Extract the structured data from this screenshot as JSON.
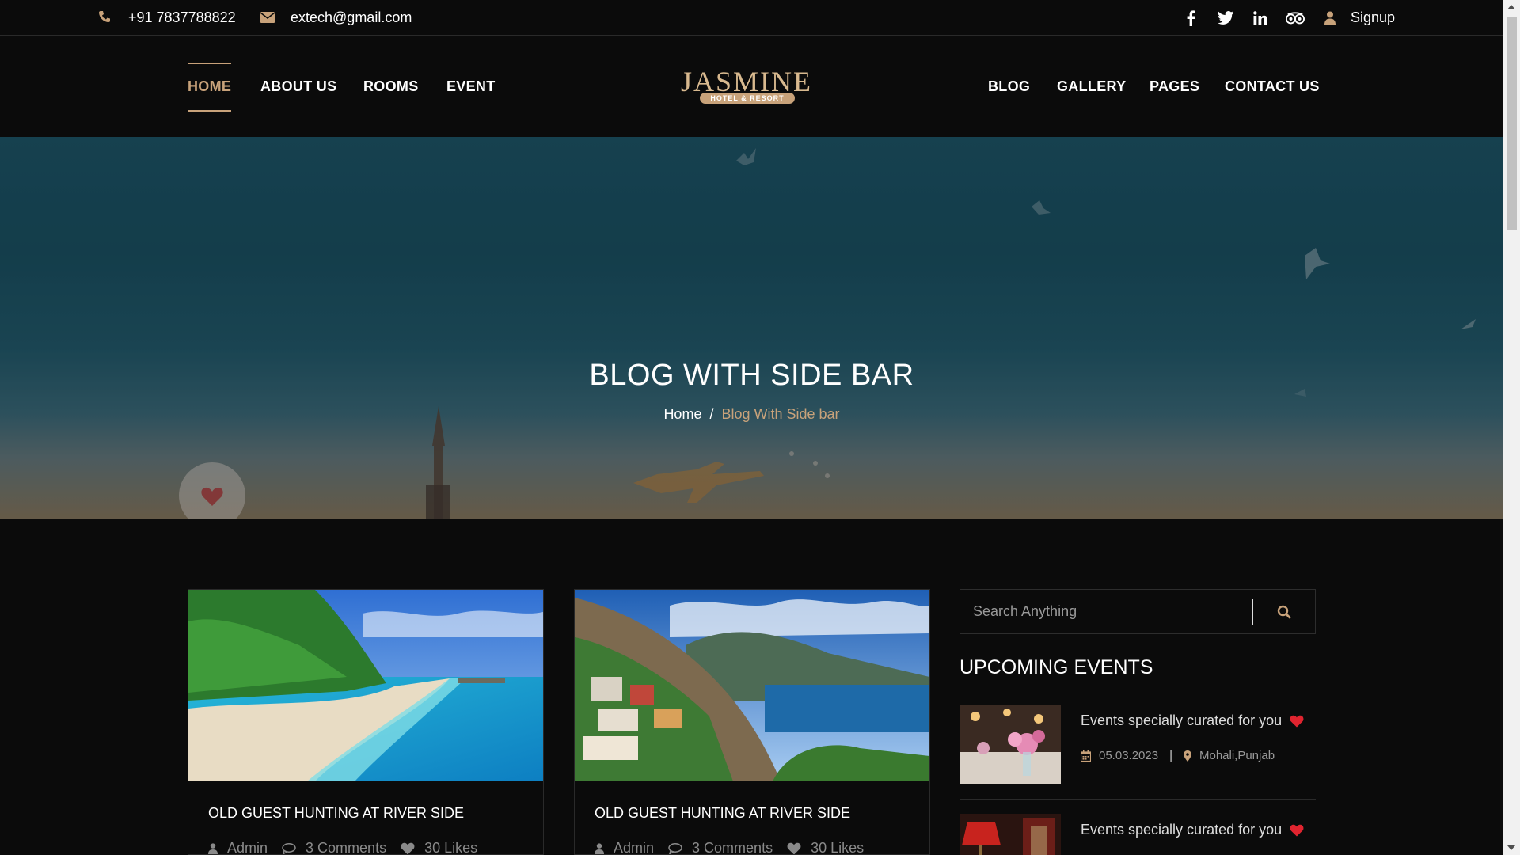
{
  "topbar": {
    "phone": "+91 7837788822",
    "email": "extech@gmail.com",
    "social_icons": [
      "facebook-icon",
      "twitter-icon",
      "linkedin-icon",
      "tripadvisor-icon"
    ],
    "signup_label": "Signup"
  },
  "nav": {
    "left_items": [
      "HOME",
      "ABOUT US",
      "ROOMS",
      "EVENT"
    ],
    "right_items": [
      "BLOG",
      "GALLERY",
      "PAGES",
      "CONTACT US"
    ],
    "active_item": "HOME",
    "logo_main": "JASMINE",
    "logo_sub": "HOTEL & RESORT"
  },
  "hero": {
    "title": "BLOG WITH SIDE BAR",
    "breadcrumb_home": "Home",
    "breadcrumb_sep": "/",
    "breadcrumb_current": "Blog With Side bar"
  },
  "posts": [
    {
      "title": "OLD GUEST HUNTING AT RIVER SIDE",
      "author": "Admin",
      "comments": "3 Comments",
      "likes": "30 Likes"
    },
    {
      "title": "OLD GUEST HUNTING AT RIVER SIDE",
      "author": "Admin",
      "comments": "3 Comments",
      "likes": "30 Likes"
    }
  ],
  "sidebar": {
    "search_placeholder": "Search Anything",
    "upcoming_heading": "UPCOMING EVENTS",
    "events": [
      {
        "title": "Events specially curated for you",
        "date": "05.03.2023",
        "location": "Mohali,Punjab"
      },
      {
        "title": "Events specially curated for you"
      }
    ]
  },
  "colors": {
    "accent": "#c8a27a",
    "background": "#0b0b0b",
    "heart": "#e0242f"
  }
}
